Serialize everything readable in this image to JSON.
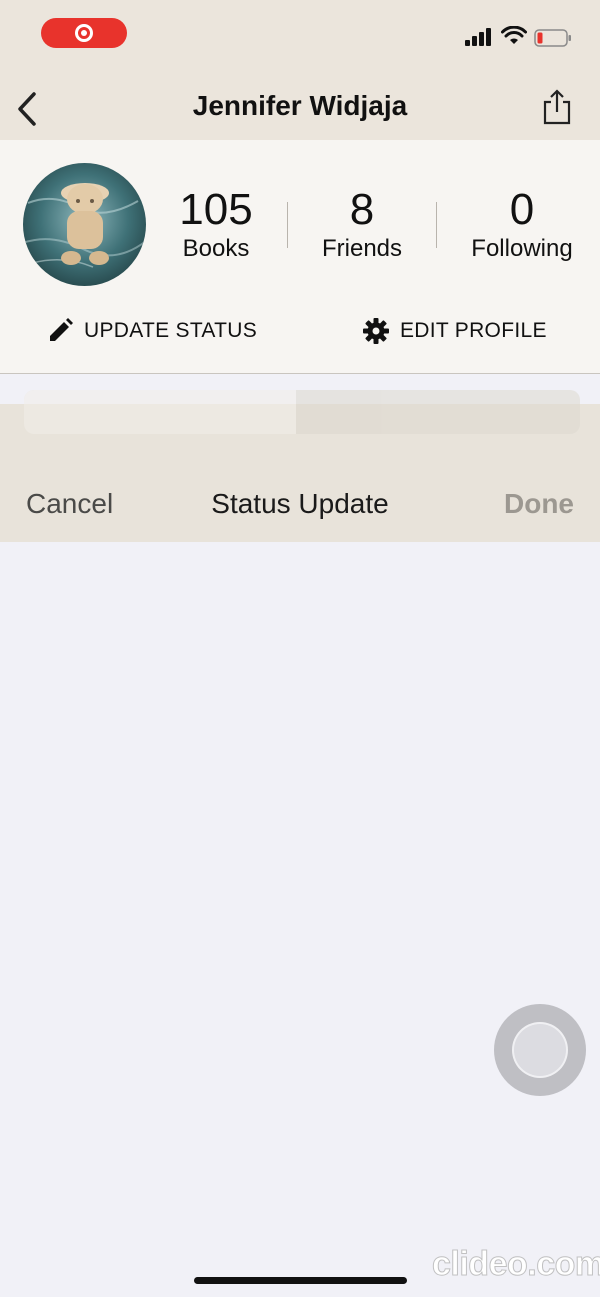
{
  "navbar": {
    "title": "Jennifer Widjaja"
  },
  "profile": {
    "stats": [
      {
        "value": "105",
        "label": "Books"
      },
      {
        "value": "8",
        "label": "Friends"
      },
      {
        "value": "0",
        "label": "Following"
      }
    ],
    "update_status_label": "UPDATE STATUS",
    "edit_profile_label": "EDIT PROFILE"
  },
  "sheet": {
    "cancel_label": "Cancel",
    "title": "Status Update",
    "done_label": "Done"
  },
  "watermark": "clideo.com",
  "colors": {
    "header_bg": "#ebe5dc",
    "record_red": "#e8332c",
    "sheet_bg": "#f1f1f7",
    "battery_low": "#e8332c"
  },
  "icons": [
    "record-icon",
    "signal-icon",
    "wifi-icon",
    "battery-icon",
    "back-chevron-icon",
    "share-icon",
    "pencil-icon",
    "gear-icon"
  ]
}
